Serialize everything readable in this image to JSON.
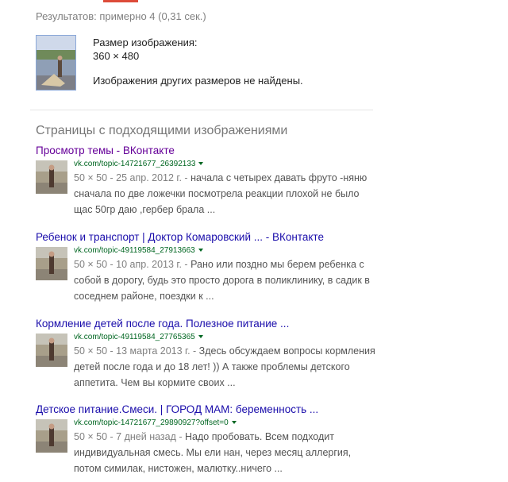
{
  "header": {
    "stats": "Результатов: примерно 4 (0,31 сек.)"
  },
  "image_info": {
    "size_label": "Размер изображения:",
    "size_value": "360 × 480",
    "other_sizes": "Изображения других размеров не найдены."
  },
  "pages_section": {
    "title": "Страницы с подходящими изображениями"
  },
  "results": [
    {
      "title": "Просмотр темы - ВКонтакте",
      "visited": true,
      "url": "vk.com/topic-14721677_26392133",
      "meta": "50 × 50 - 25 апр. 2012 г. -",
      "snippet": " начала с четырех давать фруто -няню сначала по две ложечки посмотрела реакции плохой не было щас 50гр даю ,гербер брала ..."
    },
    {
      "title": "Ребенок и транспорт | Доктор Комаровский ... - ВКонтакте",
      "visited": false,
      "url": "vk.com/topic-49119584_27913663",
      "meta": "50 × 50 - 10 апр. 2013 г. -",
      "snippet": " Рано или поздно мы берем ребенка с собой в дорогу, будь это просто дорога в поликлинику, в садик в соседнем районе, поездки к ..."
    },
    {
      "title": "Кормление детей после года. Полезное питание ...",
      "visited": false,
      "url": "vk.com/topic-49119584_27765365",
      "meta": "50 × 50 - 13 марта 2013 г. -",
      "snippet": " Здесь обсуждаем вопросы кормления детей после года и до 18 лет! )) А также проблемы детского аппетита. Чем вы кормите своих ..."
    },
    {
      "title": "Детское питание.Смеси. | ГОРОД МАМ: беременность ...",
      "visited": false,
      "url": "vk.com/topic-14721677_29890927?offset=0",
      "meta": "50 × 50 - 7 дней назад -",
      "snippet": " Надо пробовать. Всем подходит индивидуальная смесь. Мы ели нан, через месяц аллергия, потом симилак, нистожен, малютку..ничего ..."
    }
  ],
  "colors": {
    "link": "#1a0dab",
    "visited_link": "#660099",
    "url_green": "#006621",
    "snippet_gray": "#545454",
    "accent_red": "#dd4b39"
  }
}
